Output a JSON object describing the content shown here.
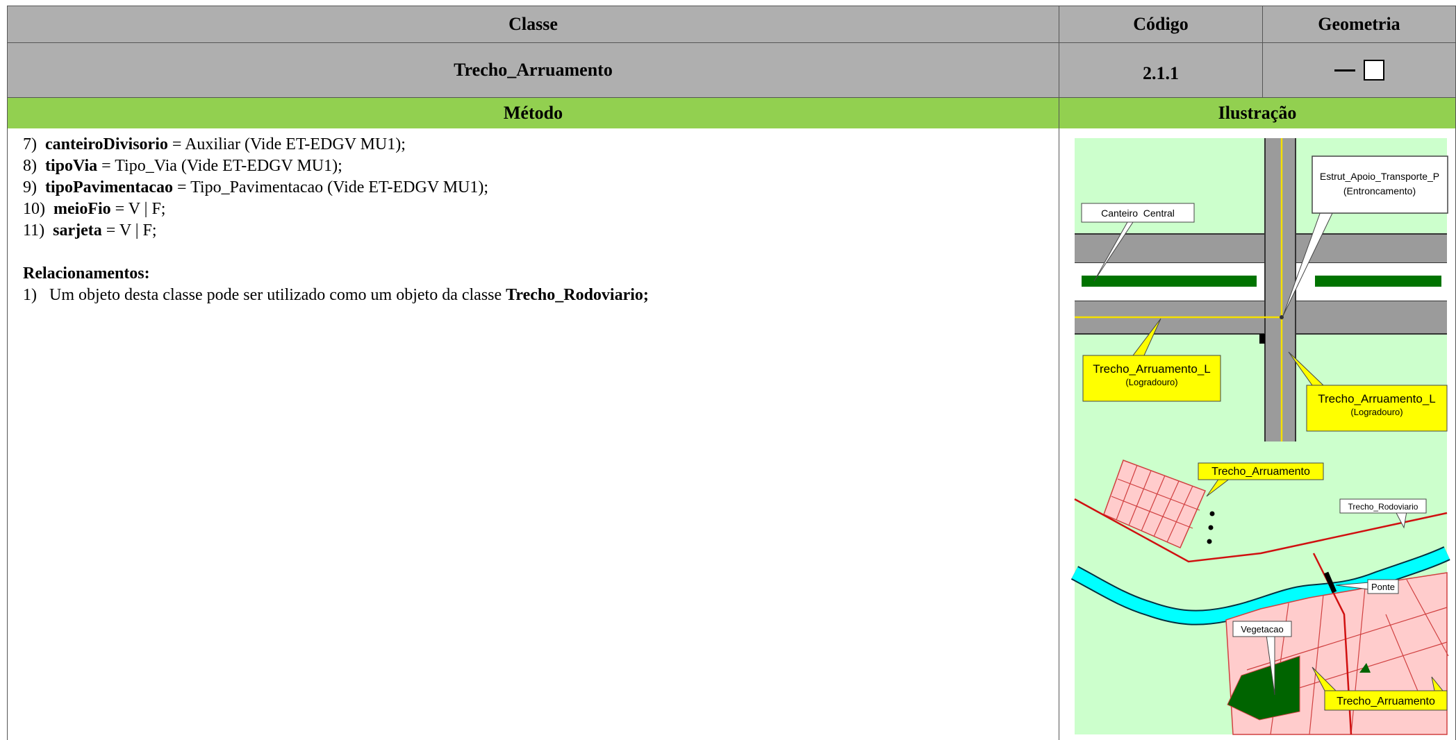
{
  "header": {
    "col_classe": "Classe",
    "col_codigo": "Código",
    "col_geometria": "Geometria"
  },
  "record": {
    "classe": "Trecho_Arruamento",
    "codigo": "2.1.1"
  },
  "section": {
    "metodo": "Método",
    "ilustracao": "Ilustração"
  },
  "method": {
    "items": [
      {
        "num": "7)",
        "attr": "canteiroDivisorio",
        "rest": " = Auxiliar (Vide ET-EDGV MU1);"
      },
      {
        "num": "8)",
        "attr": "tipoVia",
        "rest": " = Tipo_Via (Vide ET-EDGV MU1);"
      },
      {
        "num": "9)",
        "attr": "tipoPavimentacao",
        "rest": " = Tipo_Pavimentacao (Vide ET-EDGV MU1);"
      },
      {
        "num": "10)",
        "attr": "meioFio",
        "rest": " = V | F;"
      },
      {
        "num": "11)",
        "attr": "sarjeta",
        "rest": " = V | F;"
      }
    ],
    "rel_title": "Relacionamentos:",
    "rel_num": "1)",
    "rel_text": "Um objeto desta classe pode ser utilizado como um objeto da classe ",
    "rel_class": "Trecho_Rodoviario;"
  },
  "illustration": {
    "top_labels": {
      "canteiro": "Canteiro  Central",
      "estrut_1": "Estrut_Apoio_Transporte_P",
      "estrut_2": "(Entroncamento)",
      "trecho_left_1": "Trecho_Arruamento_L",
      "trecho_left_2": "(Logradouro)",
      "trecho_right_1": "Trecho_Arruamento_L",
      "trecho_right_2": "(Logradouro)"
    },
    "bottom_labels": {
      "trecho_top": "Trecho_Arruamento",
      "rodoviario": "Trecho_Rodoviario",
      "ponte": "Ponte",
      "vegetacao": "Vegetacao",
      "trecho_bottom": "Trecho_Arruamento"
    },
    "colors": {
      "background": "#ccffcc",
      "road": "#9b9b9b",
      "median": "#007300",
      "centerline": "#f5e000",
      "callout_yellow": "#ffff00",
      "river": "#00ffff",
      "block_fill": "#ffcccc",
      "block_line": "#d04040",
      "rodovia": "#d01010",
      "vegetation": "#006400"
    }
  }
}
